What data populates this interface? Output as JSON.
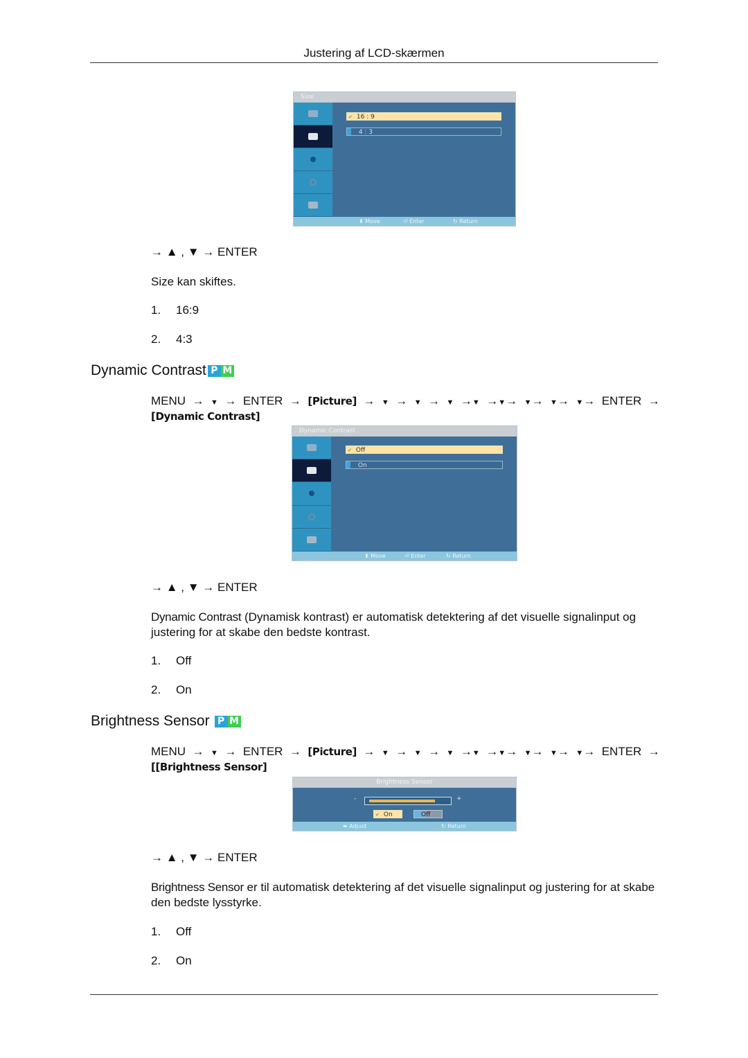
{
  "header": {
    "title": "Justering af LCD-skærmen"
  },
  "size_section": {
    "osd": {
      "title": "Size",
      "options": [
        {
          "label": "16 : 9",
          "selected": true
        },
        {
          "label": "4 : 3",
          "selected": false
        }
      ],
      "sidebar_icons": [
        "input-icon",
        "picture-icon",
        "sound-icon",
        "setup-icon",
        "multi-control-icon"
      ],
      "active_sidebar_index": 1,
      "footer": {
        "move": "Move",
        "enter": "Enter",
        "return": "Return"
      }
    },
    "nav": "→ ▲ , ▼ → ENTER",
    "desc_bold": "Size",
    "desc_rest": " kan skiftes.",
    "items": [
      {
        "num": "1.",
        "label": "16:9"
      },
      {
        "num": "2.",
        "label": "4:3"
      }
    ]
  },
  "dynamic_contrast": {
    "title": "Dynamic Contrast",
    "badges": {
      "p": "P",
      "m": "M"
    },
    "path": {
      "menu": "MENU",
      "arrow": "→",
      "down": "▼",
      "enter": "ENTER",
      "picture": "[Picture]",
      "target": "[Dynamic Contrast]"
    },
    "osd": {
      "title": "Dynamic Contrast",
      "options": [
        {
          "label": "Off",
          "selected": true
        },
        {
          "label": "On",
          "selected": false
        }
      ],
      "footer": {
        "move": "Move",
        "enter": "Enter",
        "return": "Return"
      }
    },
    "nav": "→ ▲ , ▼ → ENTER",
    "desc_bold": "Dynamic Contrast",
    "desc_rest": " (Dynamisk kontrast) er automatisk detektering af det visuelle signalinput og justering for at skabe den bedste kontrast.",
    "items": [
      {
        "num": "1.",
        "label": "Off"
      },
      {
        "num": "2.",
        "label": "On"
      }
    ]
  },
  "brightness_sensor": {
    "title": "Brightness Sensor",
    "badges": {
      "p": "P",
      "m": "M"
    },
    "path": {
      "menu": "MENU",
      "arrow": "→",
      "down": "▼",
      "enter": "ENTER",
      "picture": "[Picture]",
      "target": "[[Brightness Sensor]"
    },
    "osd": {
      "title": "Brightness Sensor",
      "minus": "-",
      "plus": "+",
      "level": 0.85,
      "buttons": [
        {
          "label": "On",
          "selected": true
        },
        {
          "label": "Off",
          "selected": false
        }
      ],
      "footer": {
        "adjust": "Adjust",
        "return": "Return"
      }
    },
    "nav": "→ ▲ , ▼ → ENTER",
    "desc_bold": "Brightness Sensor",
    "desc_rest": "  er til automatisk detektering af det visuelle signalinput og justering for at skabe den bedste lysstyrke.",
    "items": [
      {
        "num": "1.",
        "label": "Off"
      },
      {
        "num": "2.",
        "label": "On"
      }
    ]
  },
  "colors": {
    "osd_bg": "#3f6f98",
    "osd_sidebar": "#2f93c2",
    "osd_selected": "#fde3a4",
    "badge_p": "#2aa3d8",
    "badge_m": "#3ccf4e"
  }
}
